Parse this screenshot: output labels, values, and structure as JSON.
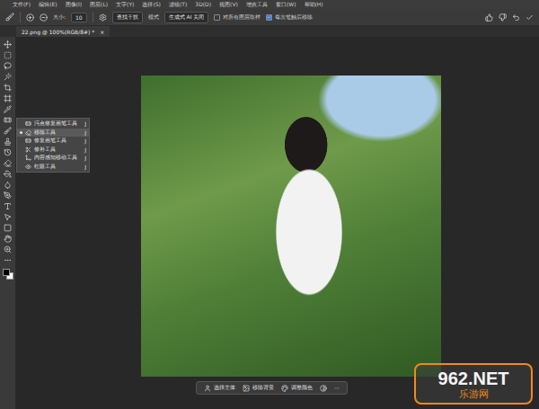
{
  "menu_bar": [
    "文件(F)",
    "编辑(E)",
    "图像(I)",
    "图层(L)",
    "文字(Y)",
    "选择(S)",
    "滤镜(T)",
    "3D(D)",
    "视图(V)",
    "增效工具",
    "窗口(W)",
    "帮助(H)"
  ],
  "options_bar": {
    "size_label": "大小:",
    "size_value": "10",
    "preset": "查找干扰",
    "mode_label": "模式",
    "mode_value": "生成式 AI 关闭",
    "checkboxes": [
      {
        "label": "对所有图层取样",
        "checked": false
      },
      {
        "label": "每次笔触后移除",
        "checked": true
      }
    ]
  },
  "document_tab": {
    "title": "22.png @ 100%(RGB/8#) *",
    "close": "×"
  },
  "tool_flyout": [
    {
      "label": "污点修复画笔工具",
      "shortcut": "J",
      "selected": false
    },
    {
      "label": "移除工具",
      "shortcut": "J",
      "selected": true
    },
    {
      "label": "修复画笔工具",
      "shortcut": "J",
      "selected": false
    },
    {
      "label": "修补工具",
      "shortcut": "J",
      "selected": false
    },
    {
      "label": "内容感知移动工具",
      "shortcut": "J",
      "selected": false
    },
    {
      "label": "红眼工具",
      "shortcut": "J",
      "selected": false
    }
  ],
  "taskbar": {
    "buttons": [
      "选择主体",
      "移除背景",
      "调整颜色"
    ],
    "more": "···"
  },
  "watermark": {
    "logo": "962.NET",
    "subtitle": "乐游网"
  }
}
